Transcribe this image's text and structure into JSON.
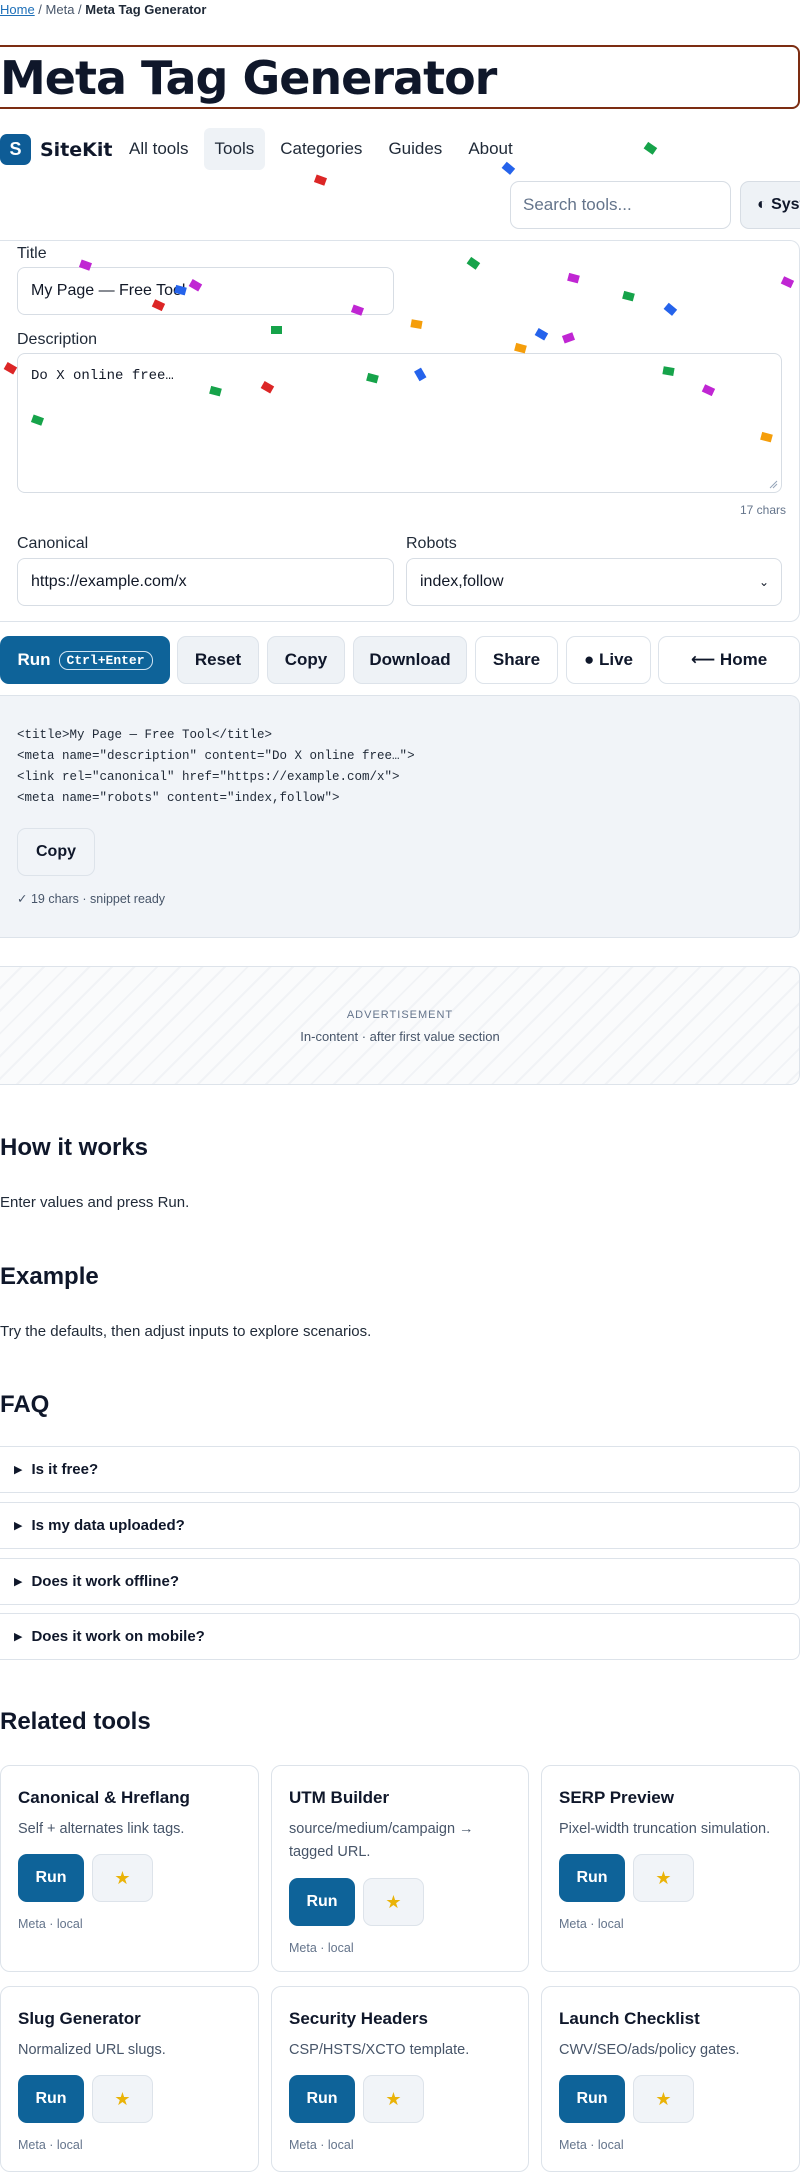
{
  "breadcrumb": {
    "home": "Home",
    "sep": " / ",
    "section": "Meta",
    "current": "Meta Tag Generator"
  },
  "page_title": "Meta Tag Generator",
  "brand": {
    "logo_letter": "S",
    "name": "SiteKit"
  },
  "nav": [
    "All tools",
    "Tools",
    "Categories",
    "Guides",
    "About"
  ],
  "search": {
    "placeholder": "Search tools..."
  },
  "system_button": "◐ System",
  "form": {
    "title_label": "Title",
    "title_value": "My Page — Free Tool",
    "description_label": "Description",
    "description_value": "Do X online free…",
    "description_count": "17 chars",
    "canonical_label": "Canonical",
    "canonical_value": "https://example.com/x",
    "robots_label": "Robots",
    "robots_value": "index,follow"
  },
  "actions": {
    "run": "Run",
    "run_kbd": "Ctrl+Enter",
    "reset": "Reset",
    "copy": "Copy",
    "download": "Download",
    "share": "Share",
    "live": "● Live",
    "home": "⟵ Home"
  },
  "output": {
    "lines": [
      "<title>My Page — Free Tool</title>",
      "<meta name=\"description\" content=\"Do X online free…\">",
      "<link rel=\"canonical\" href=\"https://example.com/x\">",
      "<meta name=\"robots\" content=\"index,follow\">"
    ],
    "copy": "Copy",
    "status": "✓ 19 chars · snippet ready"
  },
  "ad": {
    "label": "ADVERTISEMENT",
    "sub": "In-content · after first value section"
  },
  "how": {
    "heading": "How it works",
    "text": "Enter values and press Run."
  },
  "example": {
    "heading": "Example",
    "text": "Try the defaults, then adjust inputs to explore scenarios."
  },
  "faq": {
    "heading": "FAQ",
    "items": [
      "Is it free?",
      "Is my data uploaded?",
      "Does it work offline?",
      "Does it work on mobile?"
    ]
  },
  "related": {
    "heading": "Related tools",
    "run_label": "Run",
    "star_icon": "★",
    "items": [
      {
        "title": "Canonical & Hreflang",
        "desc": "Self + alternates link tags.",
        "meta": "Meta · local"
      },
      {
        "title": "UTM Builder",
        "desc": "source/medium/campaign → tagged URL.",
        "meta": "Meta · local"
      },
      {
        "title": "SERP Preview",
        "desc": "Pixel-width truncation simulation.",
        "meta": "Meta · local"
      },
      {
        "title": "Slug Generator",
        "desc": "Normalized URL slugs.",
        "meta": "Meta · local"
      },
      {
        "title": "Security Headers",
        "desc": "CSP/HSTS/XCTO template.",
        "meta": "Meta · local"
      },
      {
        "title": "Launch Checklist",
        "desc": "CWV/SEO/ads/policy gates.",
        "meta": "Meta · local"
      }
    ]
  },
  "colors": {
    "accent": "#0e6399",
    "title_border": "#7c2d12",
    "confetti": [
      "#c026d3",
      "#2563eb",
      "#16a34a",
      "#f59e0b",
      "#dc2626"
    ]
  }
}
